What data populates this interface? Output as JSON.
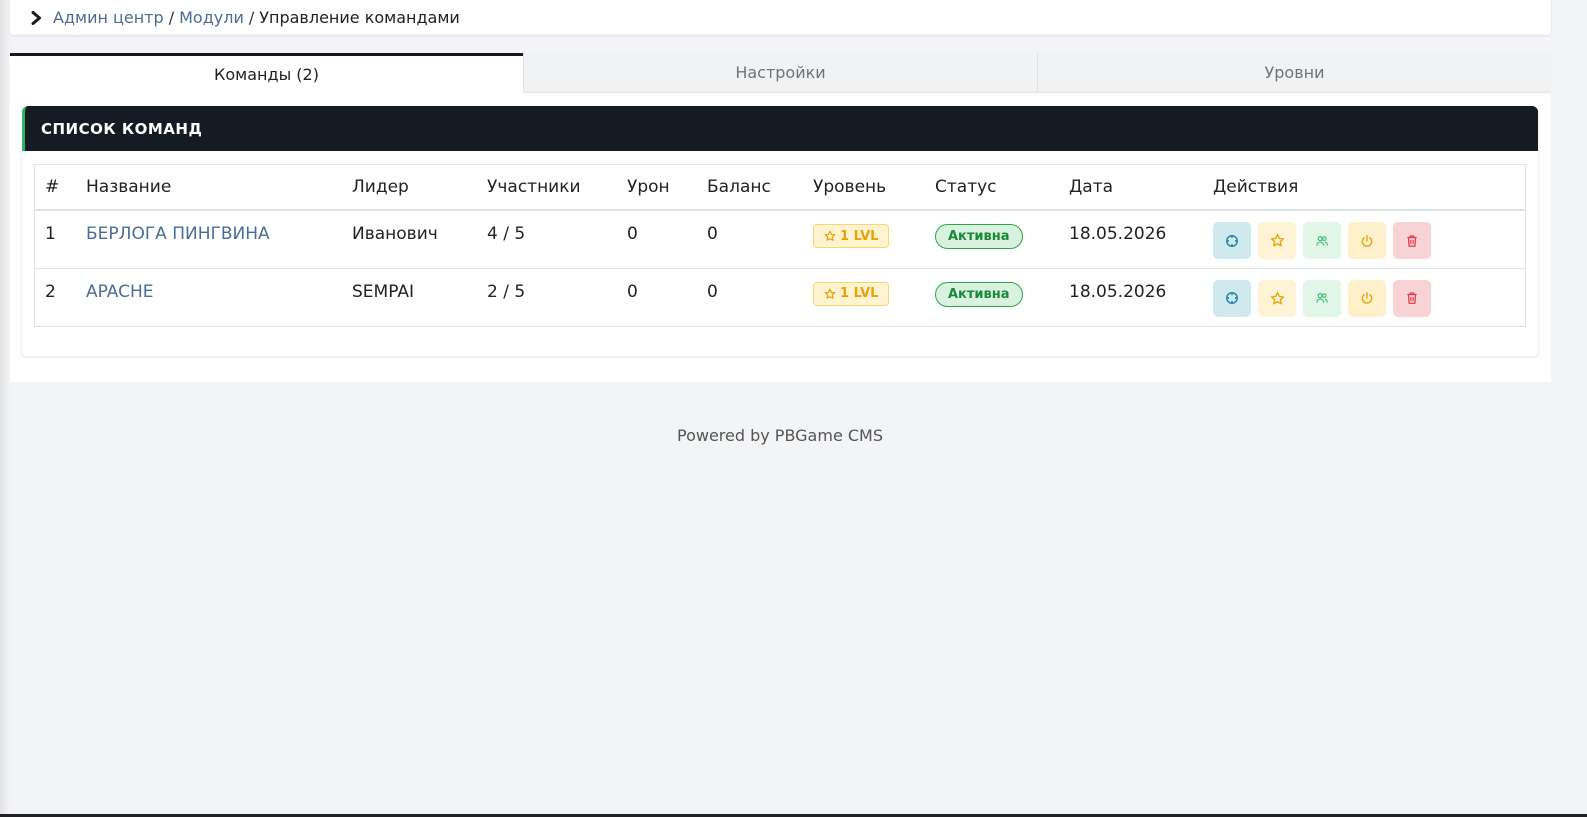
{
  "breadcrumb": {
    "items": [
      "Админ центр",
      "Модули"
    ],
    "separator": "/",
    "current": "Управление командами"
  },
  "tabs": [
    {
      "label": "Команды (2)",
      "active": true
    },
    {
      "label": "Настройки",
      "active": false
    },
    {
      "label": "Уровни",
      "active": false
    }
  ],
  "card": {
    "title": "СПИСОК КОМАНД"
  },
  "table": {
    "headers": [
      "#",
      "Название",
      "Лидер",
      "Участники",
      "Урон",
      "Баланс",
      "Уровень",
      "Статус",
      "Дата",
      "Действия"
    ],
    "rows": [
      {
        "num": "1",
        "name": "БЕРЛОГА ПИНГВИНА",
        "leader": "Иванович",
        "members": "4 / 5",
        "damage": "0",
        "balance": "0",
        "level": "1 LVL",
        "status": "Активна",
        "date": "18.05.2026"
      },
      {
        "num": "2",
        "name": "APACHE",
        "leader": "SEMPAI",
        "members": "2 / 5",
        "damage": "0",
        "balance": "0",
        "level": "1 LVL",
        "status": "Активна",
        "date": "18.05.2026"
      }
    ],
    "actions": [
      "info-icon",
      "star-icon",
      "members-icon",
      "power-icon",
      "trash-icon"
    ]
  },
  "footer": {
    "text": "Powered by PBGame CMS"
  },
  "colors": {
    "link": "#4a6d96",
    "header_bg": "#151b22",
    "accent_green": "#2fb36a",
    "level_badge": "#e9a10b",
    "status_active": "#198a38",
    "delete": "#e23b4c"
  }
}
